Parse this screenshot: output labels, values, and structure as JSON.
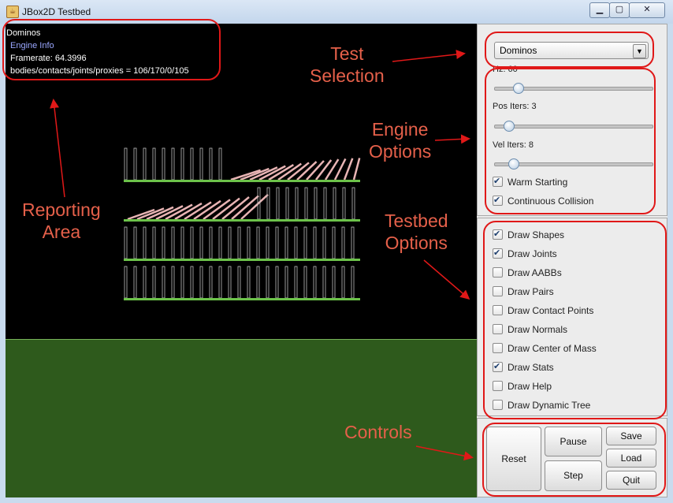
{
  "window": {
    "title": "JBox2D Testbed"
  },
  "info": {
    "test_name": "Dominos",
    "engine_info": "Engine Info",
    "framerate": "Framerate: 64.3996",
    "stats": "bodies/contacts/joints/proxies = 106/170/0/105"
  },
  "test_selection": {
    "selected": "Dominos"
  },
  "engine": {
    "hz_label": "Hz: 60",
    "pos_label": "Pos Iters: 3",
    "vel_label": "Vel Iters: 8",
    "hz_level": 0.12,
    "pos_level": 0.06,
    "vel_level": 0.09,
    "warm_starting": {
      "label": "Warm Starting",
      "checked": true
    },
    "continuous_collision": {
      "label": "Continuous Collision",
      "checked": true
    }
  },
  "testbed_options": [
    {
      "label": "Draw Shapes",
      "checked": true
    },
    {
      "label": "Draw Joints",
      "checked": true
    },
    {
      "label": "Draw AABBs",
      "checked": false
    },
    {
      "label": "Draw Pairs",
      "checked": false
    },
    {
      "label": "Draw Contact Points",
      "checked": false
    },
    {
      "label": "Draw Normals",
      "checked": false
    },
    {
      "label": "Draw Center of Mass",
      "checked": false
    },
    {
      "label": "Draw Stats",
      "checked": true
    },
    {
      "label": "Draw Help",
      "checked": false
    },
    {
      "label": "Draw Dynamic Tree",
      "checked": false
    }
  ],
  "controls": {
    "reset": "Reset",
    "pause": "Pause",
    "step": "Step",
    "save": "Save",
    "load": "Load",
    "quit": "Quit"
  },
  "annotations": {
    "test_selection": "Test\nSelection",
    "engine_options": "Engine\nOptions",
    "testbed_options": "Testbed\nOptions",
    "reporting_area": "Reporting\nArea",
    "controls": "Controls"
  },
  "colors": {
    "annotation": "#e01818",
    "annotation_text": "#e5604a",
    "ground": "#2e5a1c",
    "shelf": "#6cc24a",
    "domino": "#c0c0c0",
    "joint": "#e8b4b4"
  }
}
